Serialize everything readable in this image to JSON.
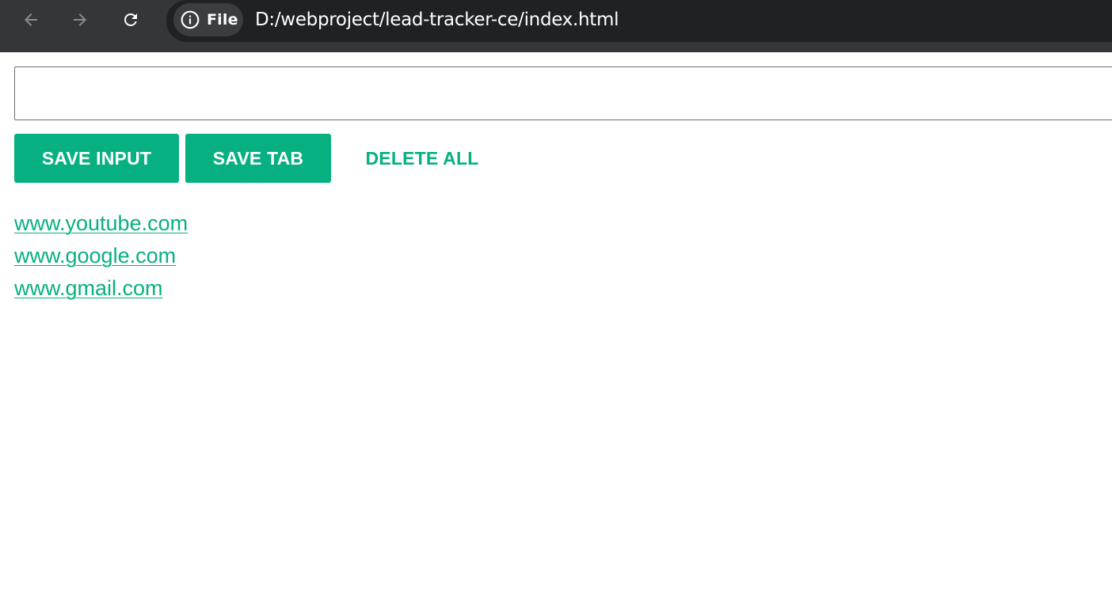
{
  "browser": {
    "nav": {
      "back_icon": "arrow-left-icon",
      "forward_icon": "arrow-right-icon",
      "reload_icon": "reload-icon"
    },
    "site_chip": {
      "icon": "info-circle-icon",
      "label": "File"
    },
    "url": "D:/webproject/lead-tracker-ce/index.html"
  },
  "app": {
    "input": {
      "value": "",
      "placeholder": ""
    },
    "buttons": {
      "save_input": "SAVE INPUT",
      "save_tab": "SAVE TAB",
      "delete_all": "DELETE ALL"
    },
    "leads": [
      "www.youtube.com",
      "www.google.com",
      "www.gmail.com"
    ]
  },
  "colors": {
    "accent": "#07b081",
    "chrome_toolbar": "#35363a",
    "omnibox": "#202124"
  }
}
